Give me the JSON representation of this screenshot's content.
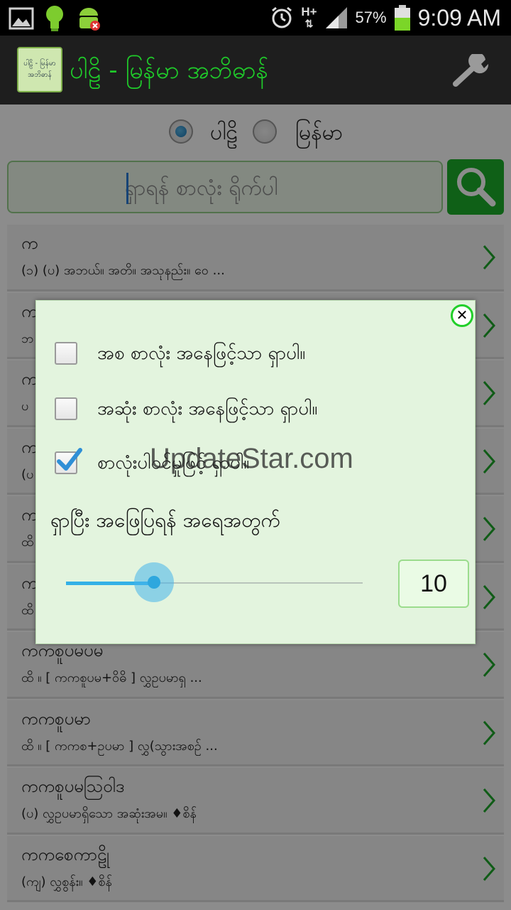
{
  "status_bar": {
    "network": "H+",
    "battery_percent": "57%",
    "battery_level": 0.57,
    "time": "9:09 AM",
    "icons": [
      "gallery-icon",
      "lightbulb-icon",
      "android-debug-icon",
      "alarm-icon",
      "signal-icon",
      "battery-icon"
    ]
  },
  "app_bar": {
    "logo_text_line1": "ပါဠိ - မြန်မာ",
    "logo_text_line2": "အဘိဓာန်",
    "title": "ပါဠိ - မြန်မာ အဘိဓာန်",
    "icons": [
      "app-logo",
      "wrench-icon"
    ]
  },
  "language_radio": {
    "options": [
      {
        "label": "ပါဠိ",
        "selected": true
      },
      {
        "label": "မြန်မာ",
        "selected": false
      }
    ]
  },
  "search": {
    "placeholder": "ရှာရန် စာလုံး ရိုက်ပါ",
    "button_icon": "search-icon"
  },
  "list": {
    "items": [
      {
        "title": "က",
        "subtitle": "(၁) (ပ) အဘယ်။ အတိ။ အသုနည်း။ ဝေ ..."
      },
      {
        "title": "က",
        "subtitle": "ဘ"
      },
      {
        "title": "က",
        "subtitle": "ပ"
      },
      {
        "title": "က",
        "subtitle": "(ပ"
      },
      {
        "title": "က",
        "subtitle": "ထိ"
      },
      {
        "title": "က",
        "subtitle": "ထိ"
      },
      {
        "title": "ကကစူပမပမ",
        "subtitle": "ထိ ။ [ ကကစူပမ+ဝိဓိ ] လွှဥပမာရှ ..."
      },
      {
        "title": "ကကစူပမာ",
        "subtitle": "ထိ ။ [ ကကစ+ဥပမာ ] လွှ(သွားအစဉ် ..."
      },
      {
        "title": "ကကစူပမသြဝါဒ",
        "subtitle": "(ပ) လွှဥပမာရှိသော အဆုံးအမ။ ♦စိန်"
      },
      {
        "title": "ကကစေကာဠို",
        "subtitle": "(ကျ) လွှစွန်း။ ♦စိန်"
      }
    ]
  },
  "dialog": {
    "options": [
      {
        "label": "အစ စာလုံး အနေဖြင့်သာ ရှာပါ။",
        "checked": false
      },
      {
        "label": "အဆုံး စာလုံး အနေဖြင့်သာ ရှာပါ။",
        "checked": false
      },
      {
        "label": "စာလုံးပါဝင်မှုဖြင့် ရှာပါ။",
        "checked": true
      }
    ],
    "watermark": "UpdateStar.com",
    "slider_heading": "ရှာပြီး အဖြေပြရန် အရေအတွက်",
    "slider_value": "10",
    "slider_fraction": 0.2,
    "close_icon": "close-icon"
  }
}
